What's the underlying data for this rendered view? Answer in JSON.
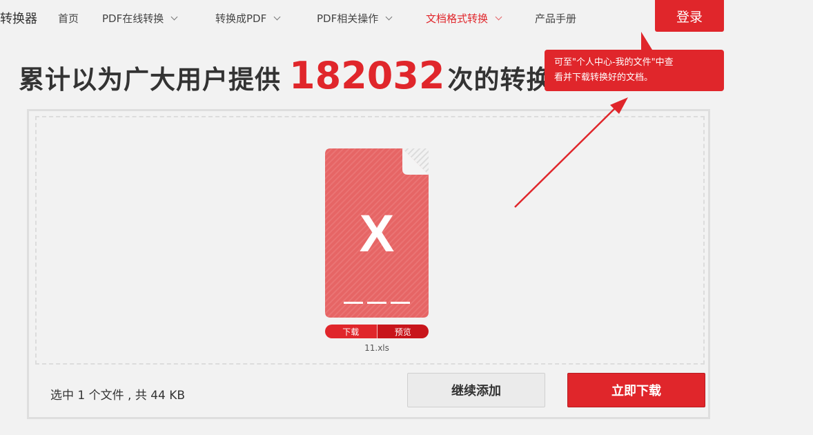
{
  "nav": {
    "brand": "转换器",
    "items": [
      {
        "label": "首页",
        "dropdown": false
      },
      {
        "label": "PDF在线转换",
        "dropdown": true
      },
      {
        "label": "转换成PDF",
        "dropdown": true
      },
      {
        "label": "PDF相关操作",
        "dropdown": true
      },
      {
        "label": "文档格式转换",
        "dropdown": true,
        "active": true
      },
      {
        "label": "产品手册",
        "dropdown": false
      }
    ],
    "login": "登录"
  },
  "headline": {
    "prefix": "累计以为广大用户提供",
    "count": "182032",
    "suffix": "次的转换"
  },
  "tooltip": {
    "line1": "可至\"个人中心-我的文件\"中查",
    "line2": "看并下载转换好的文档。"
  },
  "file": {
    "icon_letter": "X",
    "download_label": "下载",
    "preview_label": "预览",
    "name": "11.xls"
  },
  "footer": {
    "selection": "选中 1 个文件 , 共 44 KB",
    "continue_label": "继续添加",
    "download_label": "立即下载"
  },
  "colors": {
    "accent": "#e0262b",
    "file_icon": "#e66565",
    "background": "#f2f2f2"
  }
}
